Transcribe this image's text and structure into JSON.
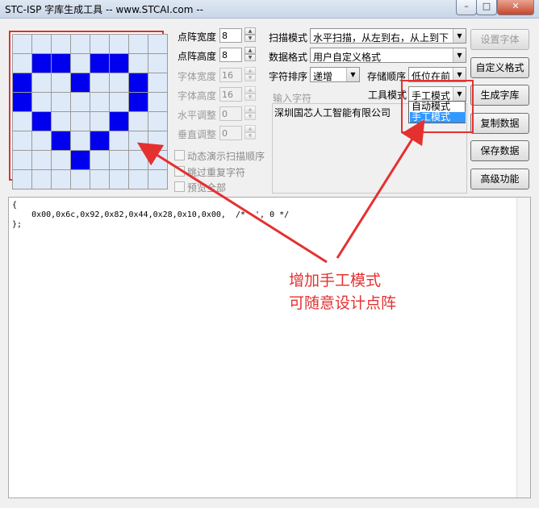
{
  "window": {
    "title": "STC-ISP 字库生成工具 -- www.STCAI.com --"
  },
  "grid": {
    "rows": [
      [
        0,
        0,
        0,
        0,
        0,
        0,
        0,
        0
      ],
      [
        0,
        1,
        1,
        0,
        1,
        1,
        0,
        0
      ],
      [
        1,
        0,
        0,
        1,
        0,
        0,
        1,
        0
      ],
      [
        1,
        0,
        0,
        0,
        0,
        0,
        1,
        0
      ],
      [
        0,
        1,
        0,
        0,
        0,
        1,
        0,
        0
      ],
      [
        0,
        0,
        1,
        0,
        1,
        0,
        0,
        0
      ],
      [
        0,
        0,
        0,
        1,
        0,
        0,
        0,
        0
      ],
      [
        0,
        0,
        0,
        0,
        0,
        0,
        0,
        0
      ]
    ],
    "on_color": "#0000ee",
    "off_color": "#dfeaf8"
  },
  "params": {
    "dot_width": {
      "label": "点阵宽度",
      "value": "8"
    },
    "dot_height": {
      "label": "点阵高度",
      "value": "8"
    },
    "font_width": {
      "label": "字体宽度",
      "value": "16"
    },
    "font_height": {
      "label": "字体高度",
      "value": "16"
    },
    "h_adjust": {
      "label": "水平调整",
      "value": "0"
    },
    "v_adjust": {
      "label": "垂直调整",
      "value": "0"
    }
  },
  "checkboxes": {
    "animate": "动态演示扫描顺序",
    "skip": "跳过重复字符",
    "preview": "预览全部"
  },
  "settings": {
    "scan_mode": {
      "label": "扫描模式",
      "value": "水平扫描，从左到右，从上到下"
    },
    "data_format": {
      "label": "数据格式",
      "value": "用户自定义格式"
    },
    "char_order": {
      "label": "字符排序",
      "value": "递增"
    },
    "store_order": {
      "label": "存储顺序",
      "value": "低位在前"
    },
    "tool_mode": {
      "label": "工具模式",
      "value": "手工模式",
      "options": [
        "自动模式",
        "手工模式"
      ]
    }
  },
  "input": {
    "label": "输入字符",
    "value": "深圳国芯人工智能有限公司"
  },
  "buttons": {
    "set_font": "设置字体",
    "custom_format": "自定义格式",
    "generate": "生成字库",
    "copy": "复制数据",
    "save": "保存数据",
    "advanced": "高级功能"
  },
  "output": {
    "lines": [
      "{",
      "    0x00,0x6c,0x92,0x82,0x44,0x28,0x10,0x00,  /*' ', 0 */",
      "};"
    ]
  },
  "annotation": {
    "line1": "增加手工模式",
    "line2": "可随意设计点阵",
    "color": "#e53030"
  }
}
